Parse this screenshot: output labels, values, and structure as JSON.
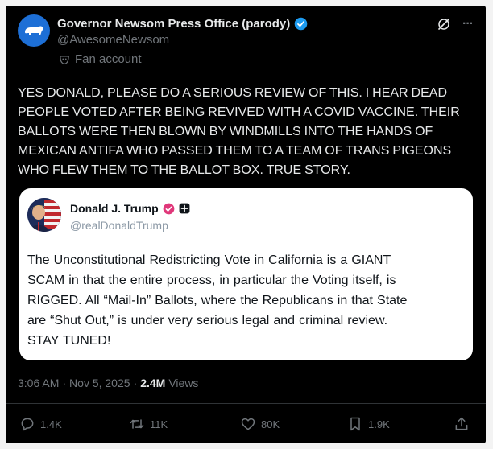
{
  "post": {
    "display_name": "Governor Newsom Press Office (parody)",
    "handle": "@AwesomeNewsom",
    "label": "Fan account",
    "text": "YES DONALD, PLEASE DO A SERIOUS REVIEW OF THIS. I HEAR DEAD\nPEOPLE VOTED AFTER BEING REVIVED WITH A COVID VACCINE. THEIR\nBALLOTS WERE THEN BLOWN BY WINDMILLS INTO THE HANDS OF\nMEXICAN ANTIFA WHO PASSED THEM TO A TEAM OF TRANS PIGEONS\nWHO FLEW THEM TO THE BALLOT BOX. TRUE STORY.",
    "time": "3:06 AM",
    "date": "Nov 5, 2025",
    "views_count": "2.4M",
    "views_label": "Views",
    "more_glyph": "···"
  },
  "quote": {
    "display_name": "Donald J. Trump",
    "handle": "@realDonaldTrump",
    "text": "The Unconstitutional Redistricting Vote in California is a GIANT\nSCAM in that the entire process, in particular the Voting itself, is\nRIGGED. All “Mail-In” Ballots, where the Republicans in that State\nare “Shut Out,” is under very serious legal and criminal review.\nSTAY TUNED!"
  },
  "stats": {
    "replies": "1.4K",
    "reposts": "11K",
    "likes": "80K",
    "bookmarks": "1.9K"
  },
  "colors": {
    "background": "#000000",
    "text_primary": "#e7e9ea",
    "text_secondary": "#71767b",
    "verified_blue": "#1d9bf0",
    "truth_badge_pink": "#e0387a",
    "avatar_blue": "#1d6fd6"
  },
  "icons": {
    "avatar": "california-bear-logo",
    "verified": "verified-badge-icon",
    "grok": "grok-icon",
    "more": "more-icon",
    "fan": "mask-icon",
    "reply": "reply-icon",
    "repost": "repost-icon",
    "like": "heart-icon",
    "bookmark": "bookmark-icon",
    "share": "share-icon"
  }
}
